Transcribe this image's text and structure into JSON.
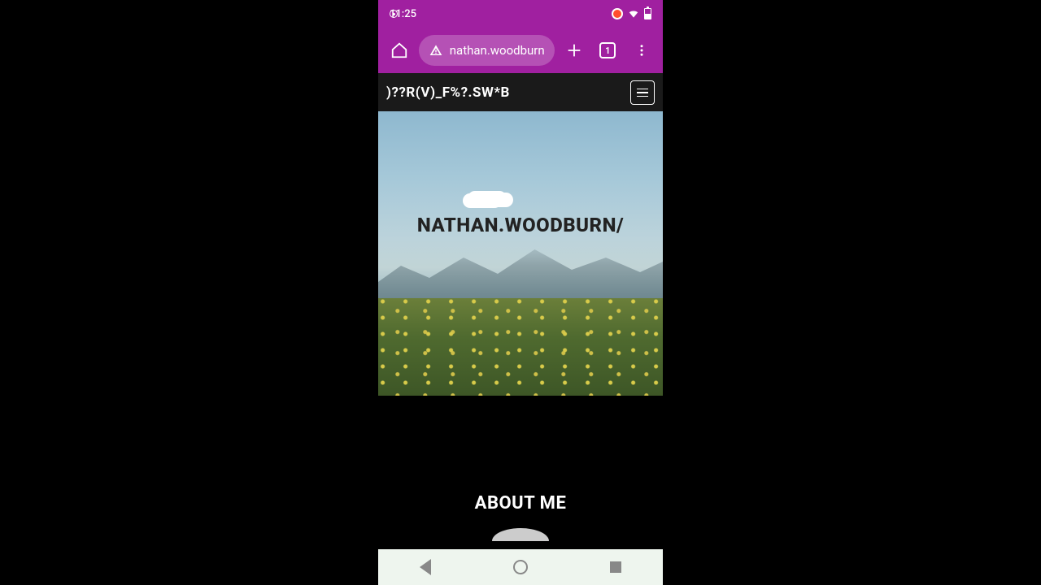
{
  "status": {
    "time": "11:25",
    "wifi": true,
    "battery_pct": 50,
    "recording": true
  },
  "chrome": {
    "url_display": "nathan.woodburn",
    "security_icon": "warning-triangle",
    "tab_count": "1"
  },
  "site": {
    "header_title": ")??R(V)_F%?.SW*B",
    "hero_title": "NATHAN.WOODBURN/",
    "about_heading": "ABOUT ME"
  }
}
